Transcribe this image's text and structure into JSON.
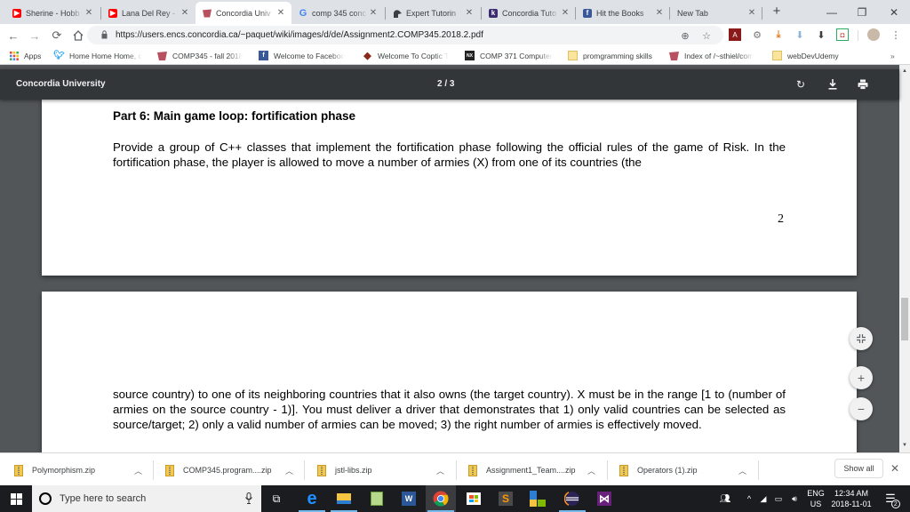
{
  "browser": {
    "tabs": [
      {
        "title": "Sherine - Hobb",
        "icon": "youtube-icon",
        "color": "#ff0000",
        "active": false
      },
      {
        "title": "Lana Del Rey -",
        "icon": "youtube-icon",
        "color": "#ff0000",
        "active": false
      },
      {
        "title": "Concordia Univ",
        "icon": "concordia-icon",
        "color": "#b8505f",
        "active": true
      },
      {
        "title": "comp 345 conc",
        "icon": "google-icon",
        "color": "#4285f4",
        "active": false
      },
      {
        "title": "Expert Tutorin",
        "icon": "tutoring-icon",
        "color": "#3c4043",
        "active": false
      },
      {
        "title": "Concordia Tuto",
        "icon": "k-icon",
        "color": "#3c2b6e",
        "active": false
      },
      {
        "title": "Hit the Books",
        "icon": "facebook-icon",
        "color": "#3b5998",
        "active": false
      },
      {
        "title": "New Tab",
        "icon": "",
        "color": "",
        "active": false
      }
    ],
    "new_tab_label": "+",
    "window_controls": {
      "minimize": "—",
      "restore": "❐",
      "close": "✕"
    },
    "address": {
      "url": "https://users.encs.concordia.ca/~paquet/wiki/images/d/de/Assignment2.COMP345.2018.2.pdf"
    },
    "bookmarks": [
      {
        "label": "Apps",
        "icon": "apps-grid-icon"
      },
      {
        "label": "Home Home Home, c",
        "icon": "twitter-icon"
      },
      {
        "label": "COMP345 - fall 2018",
        "icon": "concordia-icon"
      },
      {
        "label": "Welcome to Faceboo",
        "icon": "facebook-icon"
      },
      {
        "label": "Welcome To Coptic T",
        "icon": "coptic-icon"
      },
      {
        "label": "COMP 371 Computer",
        "icon": "comp371-icon"
      },
      {
        "label": "promgramming skills",
        "icon": "folder-icon"
      },
      {
        "label": "Index of /~sthiel/com",
        "icon": "concordia-icon"
      },
      {
        "label": "webDevUdemy",
        "icon": "folder-icon"
      }
    ],
    "bookmarks_overflow": "»"
  },
  "pdf": {
    "title": "Concordia University",
    "page_indicator": "2 / 3",
    "page_current": 2,
    "page_total": 3,
    "page2": {
      "heading": "Part 6: Main game loop: fortification phase",
      "paragraph": "Provide a group of C++ classes that implement the fortification phase following the official rules of the game of Risk. In the fortification phase, the player is allowed to move a number of armies (X) from one of its countries (the",
      "page_number": "2"
    },
    "page3": {
      "paragraph": "source country) to one of its neighboring countries that it also owns (the target country). X must be in the range [1 to (number of armies on the source country - 1)]. You must deliver a driver that demonstrates that 1) only valid countries can be selected as source/target; 2) only a valid number of armies can be moved; 3) the right number of armies is effectively moved."
    }
  },
  "downloads": {
    "items": [
      {
        "name": "Polymorphism.zip"
      },
      {
        "name": "COMP345.program....zip"
      },
      {
        "name": "jstl-libs.zip"
      },
      {
        "name": "Assignment1_Team....zip"
      },
      {
        "name": "Operators (1).zip"
      }
    ],
    "show_all_label": "Show all",
    "close_label": "✕"
  },
  "taskbar": {
    "search_placeholder": "Type here to search",
    "language": "ENG",
    "region": "US",
    "time": "12:34 AM",
    "date": "2018-11-01",
    "notification_count": "2"
  }
}
